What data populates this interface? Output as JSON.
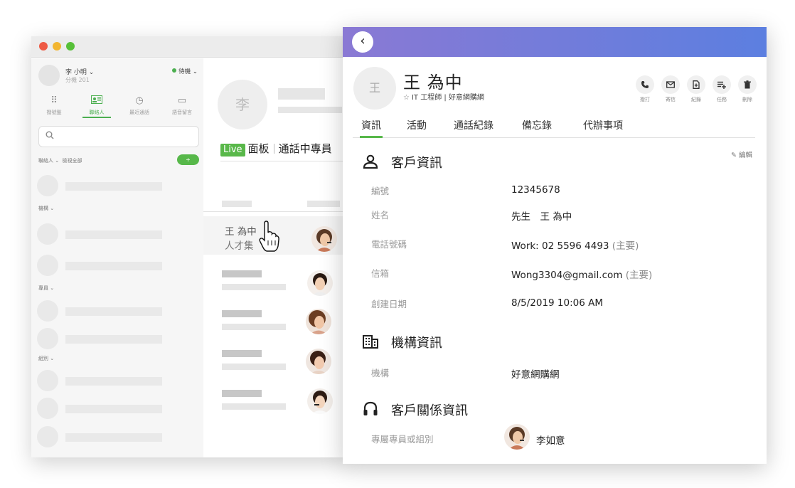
{
  "softphone": {
    "user": {
      "name": "李 小明 ⌄",
      "extension": "分機 201"
    },
    "status": "待機 ⌄",
    "nav_tabs": [
      {
        "label": "撥號盤",
        "icon": "dialpad-icon"
      },
      {
        "label": "聯絡人",
        "icon": "contact-card-icon"
      },
      {
        "label": "最近通話",
        "icon": "history-icon"
      },
      {
        "label": "語音留言",
        "icon": "voicemail-icon"
      }
    ],
    "sections": {
      "contacts": "聯絡人 ⌄",
      "show_all": "檢視全部",
      "org": "機構 ⌄",
      "sub": "專員 ⌄",
      "groups": "組別 ⌄"
    },
    "avatar_initial": "李",
    "panel_tabs": {
      "live": "Live",
      "board": "面板",
      "in_call": "通話中專員"
    },
    "highlight_row": {
      "name": "王 為中",
      "subtitle": "人才集"
    }
  },
  "contact": {
    "avatar_initial": "王",
    "name": "王 為中",
    "title": "IT 工程師 | 好意網購網",
    "actions": [
      {
        "label": "撥打",
        "icon": "phone-icon"
      },
      {
        "label": "寄信",
        "icon": "email-icon"
      },
      {
        "label": "紀錄",
        "icon": "note-add-icon"
      },
      {
        "label": "任務",
        "icon": "task-add-icon"
      },
      {
        "label": "刪除",
        "icon": "trash-icon"
      }
    ],
    "tabs": [
      "資訊",
      "活動",
      "通話紀錄",
      "備忘錄",
      "代辦事項"
    ],
    "edit_label": "編輯",
    "customer_section": {
      "heading": "客戶資訊",
      "fields": [
        {
          "label": "編號",
          "value": "12345678",
          "tag": ""
        },
        {
          "label": "姓名",
          "value": "先生　王 為中",
          "tag": ""
        },
        {
          "label": "電話號碼",
          "value": "Work: 02 5596 4493",
          "tag": "(主要)"
        },
        {
          "label": "信箱",
          "value": "Wong3304@gmail.com",
          "tag": "(主要)"
        },
        {
          "label": "創建日期",
          "value": "8/5/2019 10:06 AM",
          "tag": ""
        }
      ]
    },
    "org_section": {
      "heading": "機構資訊",
      "label": "機構",
      "value": "好意網購網"
    },
    "relation_section": {
      "heading": "客戶關係資訊",
      "label": "專屬專員或組別",
      "agent": "李如意"
    }
  },
  "colors": {
    "accent_green": "#57b84a",
    "header_start": "#8a79d4",
    "header_end": "#5c7fe0"
  }
}
